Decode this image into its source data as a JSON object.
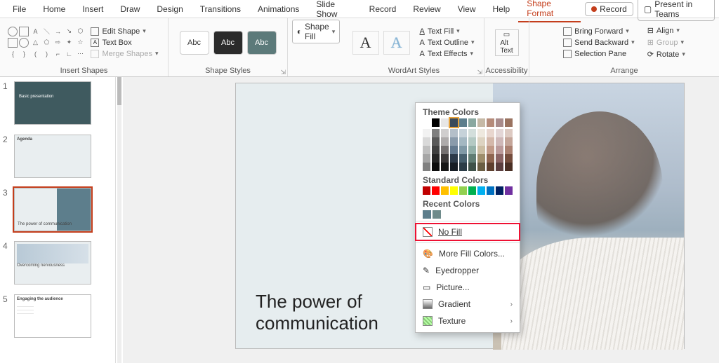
{
  "menu": [
    "File",
    "Home",
    "Insert",
    "Draw",
    "Design",
    "Transitions",
    "Animations",
    "Slide Show",
    "Record",
    "Review",
    "View",
    "Help",
    "Shape Format"
  ],
  "menu_active": "Shape Format",
  "topbtns": {
    "record": "Record",
    "present": "Present in Teams"
  },
  "ribbon": {
    "insert_shapes": {
      "label": "Insert Shapes",
      "edit_shape": "Edit Shape",
      "text_box": "Text Box",
      "merge": "Merge Shapes"
    },
    "shape_styles": {
      "label": "Shape Styles",
      "tiles": [
        "Abc",
        "Abc",
        "Abc"
      ],
      "fill": "Shape Fill"
    },
    "wordart": {
      "label": "WordArt Styles",
      "text_fill": "Text Fill",
      "text_outline": "Text Outline",
      "text_effects": "Text Effects"
    },
    "access": {
      "label": "Accessibility",
      "alt": "Alt\nText"
    },
    "arrange": {
      "label": "Arrange",
      "bring": "Bring Forward",
      "send": "Send Backward",
      "sel": "Selection Pane",
      "align": "Align",
      "group": "Group",
      "rotate": "Rotate"
    }
  },
  "dropdown": {
    "theme": "Theme Colors",
    "standard": "Standard Colors",
    "recent": "Recent Colors",
    "theme_top": [
      "#ffffff",
      "#000000",
      "#e7e6e6",
      "#3a4a5a",
      "#5d7e8c",
      "#8aa8a0",
      "#c6b9a6",
      "#b58b7a",
      "#a98c8c",
      "#9a7360"
    ],
    "theme_shades": [
      [
        "#f2f2f2",
        "#7f7f7f",
        "#d0cece",
        "#b4bfc9",
        "#c6d2d9",
        "#d3dedb",
        "#eee8de",
        "#e8d6ce",
        "#e3d6d6",
        "#ddcac2"
      ],
      [
        "#d9d9d9",
        "#595959",
        "#aeabab",
        "#8a9bab",
        "#a4b8c2",
        "#b4c9c3",
        "#ddd3c1",
        "#d4b8aa",
        "#cfb8b8",
        "#c4a599"
      ],
      [
        "#bfbfbf",
        "#404040",
        "#757171",
        "#63798e",
        "#8099a6",
        "#93b0a8",
        "#ccbea3",
        "#c19a88",
        "#bb9a9a",
        "#aa8070"
      ],
      [
        "#a6a6a6",
        "#262626",
        "#3b3838",
        "#2c3a49",
        "#47606e",
        "#607d73",
        "#9e8d6b",
        "#8f6550",
        "#8b6464",
        "#744c3c"
      ],
      [
        "#808080",
        "#0d0d0d",
        "#171717",
        "#161d25",
        "#2c3d47",
        "#3f5249",
        "#6b5e43",
        "#5e3f2e",
        "#5b3e3e",
        "#4a2f24"
      ]
    ],
    "standard_row": [
      "#c00000",
      "#ff0000",
      "#ffc000",
      "#ffff00",
      "#92d050",
      "#00b050",
      "#00b0f0",
      "#0070c0",
      "#002060",
      "#7030a0"
    ],
    "recent_colors": [
      "#5d7e8c",
      "#6f8b8b"
    ],
    "nofill": "No Fill",
    "more": "More Fill Colors...",
    "eyedrop": "Eyedropper",
    "picture": "Picture...",
    "gradient": "Gradient",
    "texture": "Texture"
  },
  "slides": [
    {
      "n": "1",
      "title": "Basic presentation"
    },
    {
      "n": "2",
      "title": "Agenda"
    },
    {
      "n": "3",
      "title": "The power of communication"
    },
    {
      "n": "4",
      "title": "Overcoming nervousness"
    },
    {
      "n": "5",
      "title": "Engaging the audience"
    }
  ],
  "slide_text": {
    "line1": "The power of",
    "line2": "communication"
  }
}
